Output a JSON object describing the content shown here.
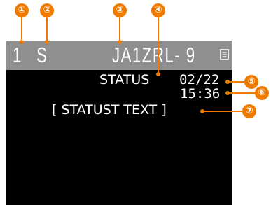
{
  "screen": {
    "channel": "1",
    "mode": "S",
    "callsign": "JA1ZRL- 9",
    "status_label": "STATUS",
    "date": "02/22",
    "time": "15:36",
    "status_text": "[ STATUST TEXT ]",
    "header_icon": "document-icon"
  },
  "callouts": [
    "①",
    "②",
    "③",
    "④",
    "⑤",
    "⑥",
    "⑦"
  ],
  "colors": {
    "header_bg": "#8f8f8f",
    "screen_bg": "#000000",
    "text": "#ffffff",
    "callout": "#ee7a00"
  }
}
